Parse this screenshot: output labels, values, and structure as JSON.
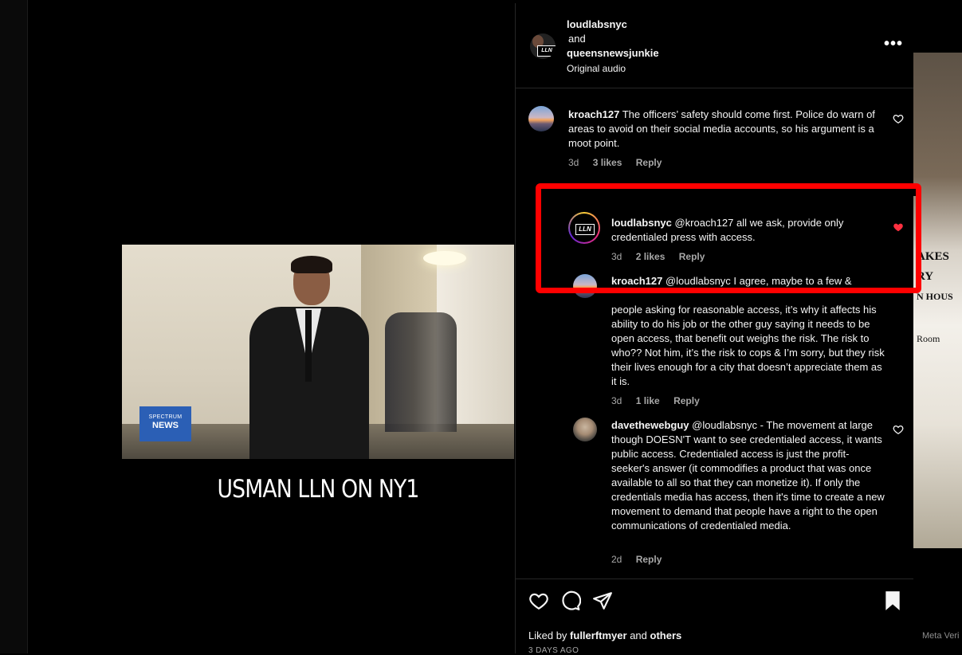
{
  "video": {
    "badge_line1": "SPECTRUM",
    "badge_line2": "NEWS",
    "caption": "USMAN LLN ON NY1"
  },
  "header": {
    "user1": "loudlabsnyc",
    "and": "and",
    "user2": "queensnewsjunkie",
    "audio": "Original audio",
    "more": "•••"
  },
  "comments": [
    {
      "user": "kroach127",
      "text": "The officers’ safety should come first. Police do warn of areas to avoid on their social media accounts, so his argument is a moot point.",
      "time": "3d",
      "likes": "3 likes",
      "reply": "Reply",
      "liked": false
    },
    {
      "user": "loudlabsnyc",
      "text": "@kroach127 all we ask, provide only credentialed press with access.",
      "time": "3d",
      "likes": "2 likes",
      "reply": "Reply",
      "liked": true
    },
    {
      "user": "kroach127",
      "text_top": "@loudlabsnyc I agree, maybe to a few &",
      "text_rest": "people asking for reasonable access, it’s why it affects his ability to do his job or the other guy saying it needs to be open access, that benefit out weighs the risk. The risk to who?? Not him, it’s the risk to cops & I’m sorry, but they risk their lives enough for a city that doesn’t appreciate them as it is.",
      "time": "3d",
      "likes": "1 like",
      "reply": "Reply",
      "liked": false
    },
    {
      "user": "davethewebguy",
      "text": "@loudlabsnyc - The movement at large though DOESN'T want to see credentialed access, it wants public access. Credentialed access is just the profit-seeker's answer (it commodifies a product that was once available to all so that they can monetize it). If only the credentials media has access, then it's time to create a new movement to demand that people have a right to the open communications of credentialed media.",
      "time": "2d",
      "reply": "Reply",
      "liked": false
    }
  ],
  "actions": {
    "liked_prefix": "Liked by",
    "liked_user": "fullerftmyer",
    "liked_and": "and",
    "liked_others": "others",
    "date": "3 DAYS AGO"
  },
  "avatar_text": "LLN",
  "background": {
    "sign1": "AKES",
    "sign2": "RY",
    "sign3": "N HOUS",
    "sign4": "Room",
    "meta_verified": "Meta Veri"
  },
  "colors": {
    "highlight": "#ff0000",
    "liked_heart": "#ff3040"
  }
}
